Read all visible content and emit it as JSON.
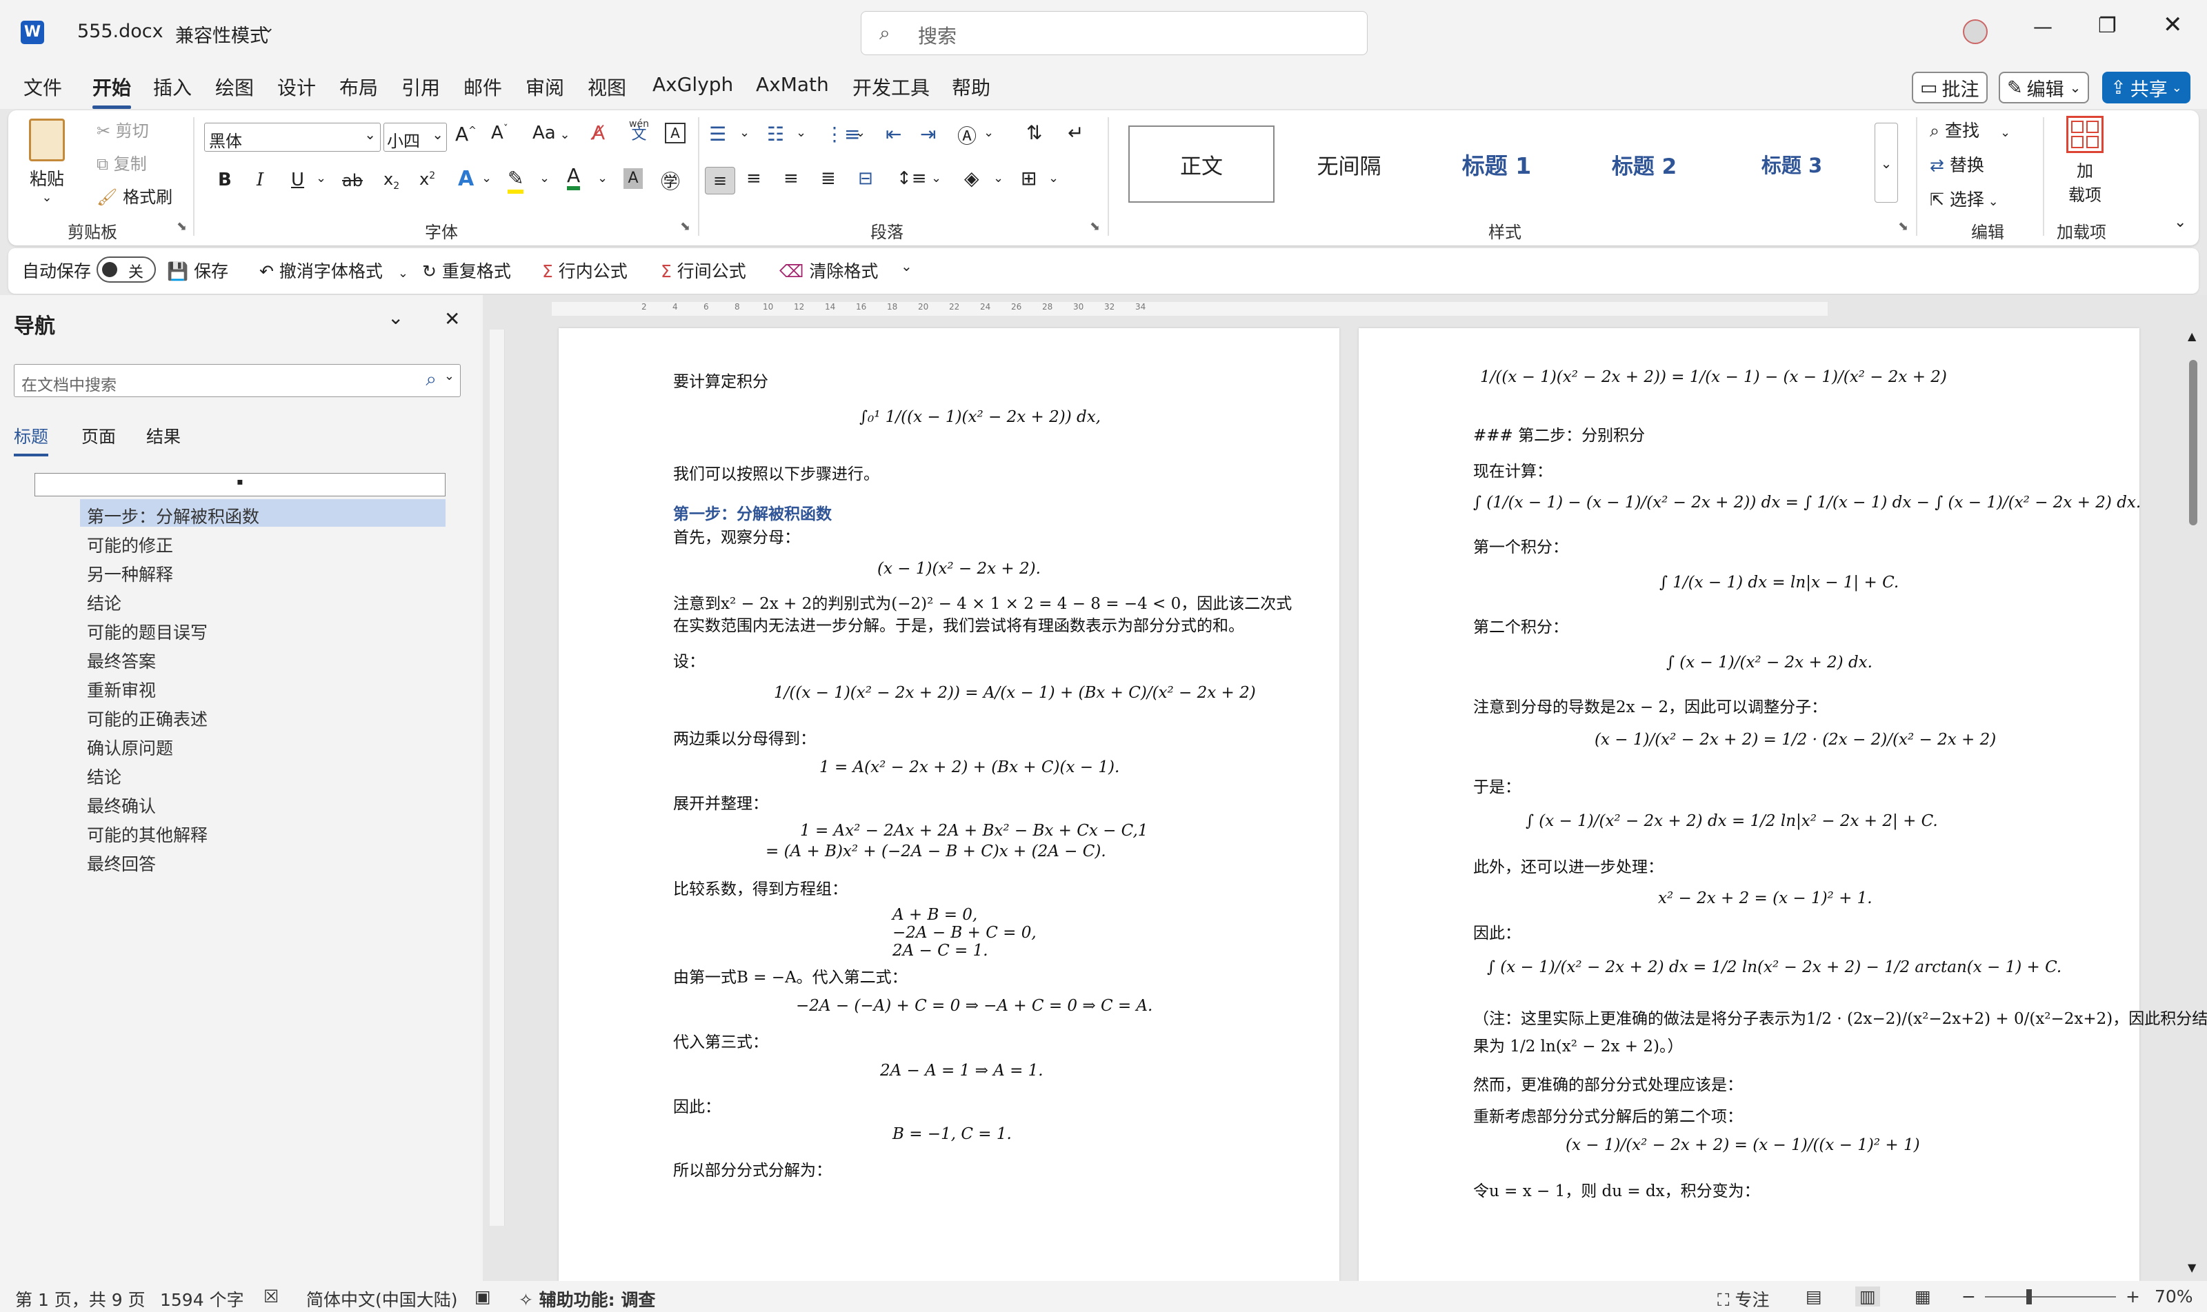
{
  "window": {
    "app_icon": "word-icon",
    "filename": "555.docx",
    "mode": "兼容性模式",
    "search_placeholder": "搜索"
  },
  "ribbon_tabs": [
    "文件",
    "开始",
    "插入",
    "绘图",
    "设计",
    "布局",
    "引用",
    "邮件",
    "审阅",
    "视图",
    "AxGlyph",
    "AxMath",
    "开发工具",
    "帮助"
  ],
  "ribbon_right": {
    "comment": "批注",
    "edit": "编辑",
    "share": "共享"
  },
  "clipboard": {
    "paste": "粘贴",
    "cut": "剪切",
    "copy": "复制",
    "format_painter": "格式刷",
    "label": "剪贴板"
  },
  "font": {
    "name": "黑体",
    "size": "小四",
    "label": "字体",
    "case_label": "Aa",
    "pinyin_top": "wén",
    "pinyin_bottom": "文"
  },
  "paragraph": {
    "label": "段落"
  },
  "styles": {
    "items": [
      "正文",
      "无间隔",
      "标题 1",
      "标题 2",
      "标题 3"
    ],
    "label": "样式"
  },
  "editing": {
    "find": "查找",
    "replace": "替换",
    "select": "选择",
    "label": "编辑"
  },
  "addins": {
    "label_top": "加",
    "label_bottom": "载项",
    "label": "加载项"
  },
  "qat": {
    "autosave": "自动保存",
    "toggle": "关",
    "save": "保存",
    "undo": "撤消字体格式",
    "redo": "重复格式",
    "inline_formula": "行内公式",
    "display_formula": "行间公式",
    "clear_format": "清除格式"
  },
  "nav": {
    "title": "导航",
    "search_placeholder": "在文档中搜索",
    "tabs": [
      "标题",
      "页面",
      "结果"
    ],
    "items": [
      "第一步：分解被积函数",
      "可能的修正",
      "另一种解释",
      "结论",
      "可能的题目误写",
      "最终答案",
      "重新审视",
      "可能的正确表述",
      "确认原问题",
      "结论",
      "最终确认",
      "可能的其他解释",
      "最终回答"
    ]
  },
  "ruler": {
    "marks": [
      "2",
      "4",
      "6",
      "8",
      "10",
      "12",
      "14",
      "16",
      "18",
      "20",
      "22",
      "24",
      "26",
      "28",
      "30",
      "32",
      "34"
    ]
  },
  "page1": {
    "lines": [
      "要计算定积分",
      "∫₀¹ 1/((x − 1)(x² − 2x + 2)) dx,",
      "我们可以按照以下步骤进行。",
      "第一步：分解被积函数",
      "首先，观察分母：",
      "(x − 1)(x² − 2x + 2).",
      "注意到x² − 2x + 2的判别式为(−2)² − 4 × 1 × 2 = 4 − 8 = −4 < 0，因此该二次式",
      "在实数范围内无法进一步分解。于是，我们尝试将有理函数表示为部分分式的和。",
      "设：",
      "1/((x − 1)(x² − 2x + 2)) = A/(x − 1) + (Bx + C)/(x² − 2x + 2)",
      "两边乘以分母得到：",
      "1 = A(x² − 2x + 2) + (Bx + C)(x − 1).",
      "展开并整理：",
      "1 = Ax² − 2Ax + 2A + Bx² − Bx + Cx − C,1",
      "= (A + B)x² + (−2A − B + C)x + (2A − C).",
      "比较系数，得到方程组：",
      "A + B = 0,",
      "−2A − B + C = 0,",
      "2A − C = 1.",
      "由第一式B = −A。代入第二式：",
      "−2A − (−A) + C = 0 ⇒ −A + C = 0 ⇒ C = A.",
      "代入第三式：",
      "2A − A = 1 ⇒ A = 1.",
      "因此：",
      "B = −1,   C = 1.",
      "所以部分分式分解为："
    ]
  },
  "page2": {
    "lines": [
      "1/((x − 1)(x² − 2x + 2)) = 1/(x − 1) − (x − 1)/(x² − 2x + 2)",
      "### 第二步：分别积分",
      "现在计算：",
      "∫ (1/(x − 1) − (x − 1)/(x² − 2x + 2)) dx = ∫ 1/(x − 1) dx − ∫ (x − 1)/(x² − 2x + 2) dx.",
      "第一个积分：",
      "∫ 1/(x − 1) dx = ln|x − 1| + C.",
      "第二个积分：",
      "∫ (x − 1)/(x² − 2x + 2) dx.",
      "注意到分母的导数是2x − 2，因此可以调整分子：",
      "(x − 1)/(x² − 2x + 2) = 1/2 · (2x − 2)/(x² − 2x + 2)",
      "于是：",
      "∫ (x − 1)/(x² − 2x + 2) dx = 1/2 ln|x² − 2x + 2| + C.",
      "此外，还可以进一步处理：",
      "x² − 2x + 2 = (x − 1)² + 1.",
      "因此：",
      "∫ (x − 1)/(x² − 2x + 2) dx = 1/2 ln(x² − 2x + 2) − 1/2 arctan(x − 1) + C.",
      "（注：这里实际上更准确的做法是将分子表示为1/2 · (2x−2)/(x²−2x+2) + 0/(x²−2x+2)，因此积分结",
      "果为 1/2 ln(x² − 2x + 2)。）",
      "然而，更准确的部分分式处理应该是：",
      "重新考虑部分分式分解后的第二个项：",
      "(x − 1)/(x² − 2x + 2) = (x − 1)/((x − 1)² + 1)",
      "令u = x − 1，则 du = dx，积分变为："
    ]
  },
  "status": {
    "page": "第 1 页，共 9 页",
    "words": "1594 个字",
    "language": "简体中文(中国大陆)",
    "accessibility": "辅助功能: 调查",
    "focus": "专注",
    "zoom": "70%"
  },
  "colors": {
    "accent": "#2b579a",
    "heading_blue": "#2f5597",
    "share_bg": "#0f6cbd",
    "nav_selected": "#c7d7f0"
  }
}
